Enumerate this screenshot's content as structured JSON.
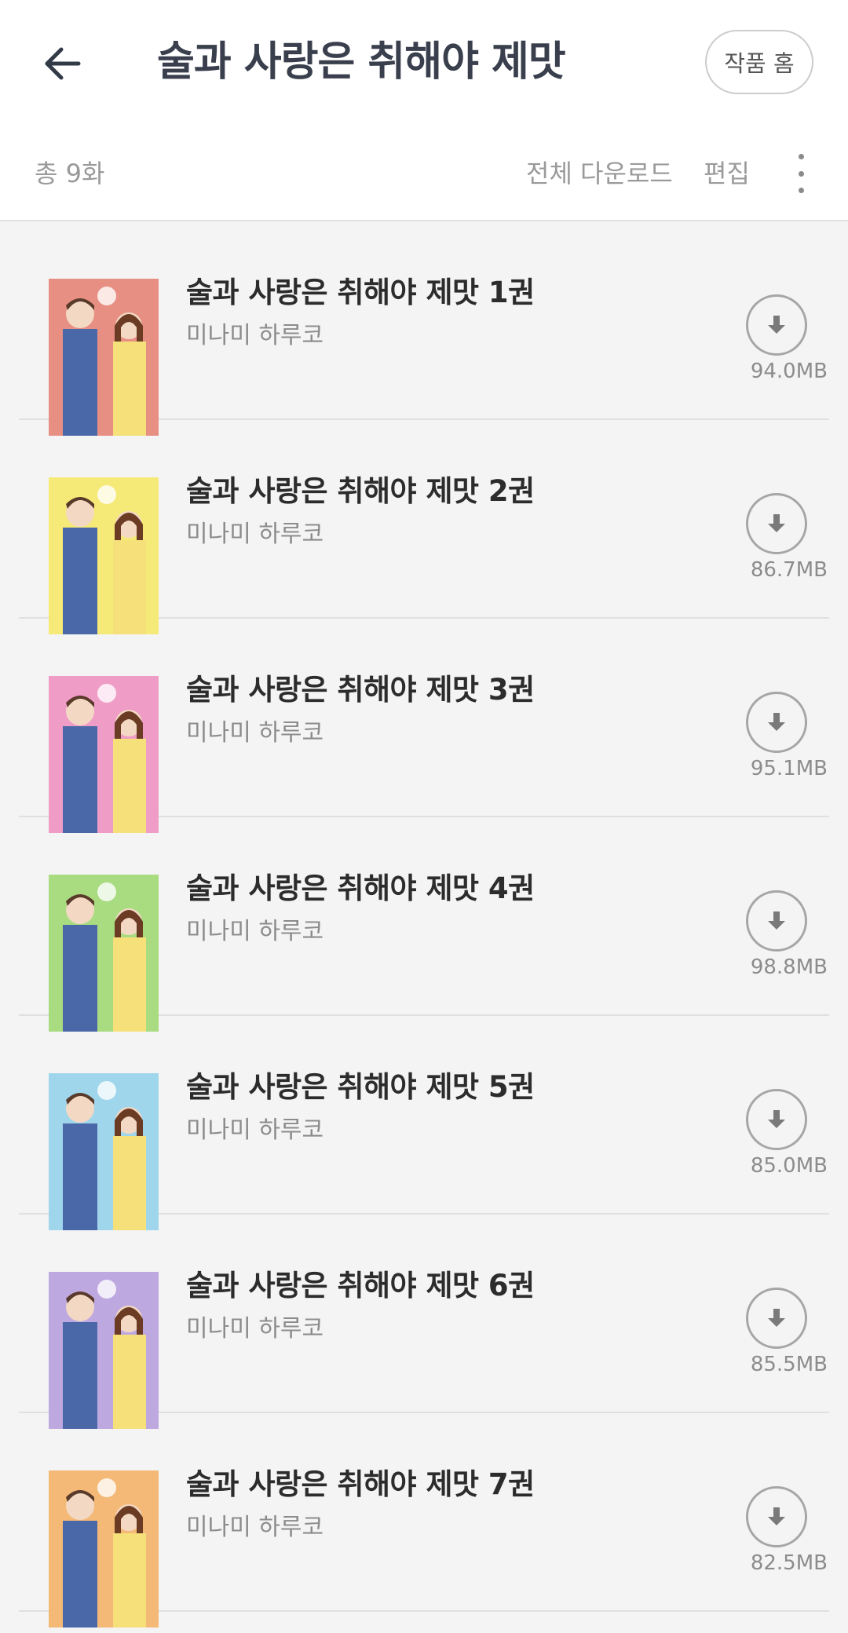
{
  "header": {
    "title": "술과 사랑은 취해야 제맛",
    "home_button": "작품 홈"
  },
  "toolbar": {
    "count": "총 9화",
    "download_all": "전체 다운로드",
    "edit": "편집"
  },
  "items": [
    {
      "title": "술과 사랑은 취해야 제맛 1권",
      "author": "미나미 하루코",
      "size": "94.0MB",
      "cover_color": "#e06a5a"
    },
    {
      "title": "술과 사랑은 취해야 제맛 2권",
      "author": "미나미 하루코",
      "size": "86.7MB",
      "cover_color": "#f2e34a"
    },
    {
      "title": "술과 사랑은 취해야 제맛 3권",
      "author": "미나미 하루코",
      "size": "95.1MB",
      "cover_color": "#ea7bb3"
    },
    {
      "title": "술과 사랑은 취해야 제맛 4권",
      "author": "미나미 하루코",
      "size": "98.8MB",
      "cover_color": "#8ccf57"
    },
    {
      "title": "술과 사랑은 취해야 제맛 5권",
      "author": "미나미 하루코",
      "size": "85.0MB",
      "cover_color": "#7fc8e6"
    },
    {
      "title": "술과 사랑은 취해야 제맛 6권",
      "author": "미나미 하루코",
      "size": "85.5MB",
      "cover_color": "#a88bd6"
    },
    {
      "title": "술과 사랑은 취해야 제맛 7권",
      "author": "미나미 하루코",
      "size": "82.5MB",
      "cover_color": "#f0a24a"
    }
  ],
  "colors": {
    "background": "#f4f4f4",
    "header_bg": "#ffffff",
    "title": "#3a3f4d",
    "muted": "#9a9a9a",
    "divider": "#e0e0e0"
  },
  "icons": {
    "back": "arrow-left-icon",
    "more": "more-vertical-icon",
    "download": "download-circle-icon"
  }
}
